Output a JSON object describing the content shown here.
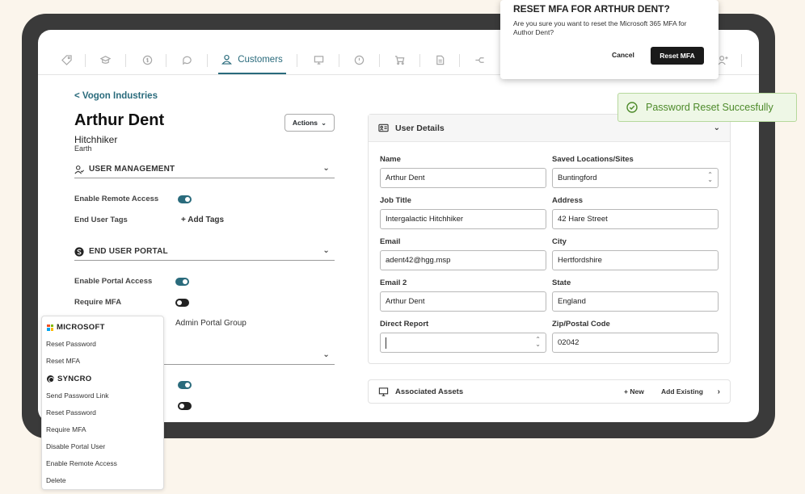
{
  "tabs": {
    "active_label": "Customers",
    "icons": [
      "tag-icon",
      "grad-cap-icon",
      "money-icon",
      "chat-icon",
      "user-icon",
      "monitor-icon",
      "alert-icon",
      "cart-icon",
      "document-icon",
      "flow-icon",
      "add-user-icon"
    ]
  },
  "customer": {
    "back_link": "< Vogon Industries",
    "name": "Arthur Dent",
    "role": "Hitchhiker",
    "location": "Earth",
    "actions_label": "Actions"
  },
  "user_management": {
    "heading": "USER MANAGEMENT",
    "remote_access_label": "Enable Remote Access",
    "remote_access_on": true,
    "tags_label": "End User Tags",
    "add_tags_label": "+ Add Tags"
  },
  "end_user_portal": {
    "heading": "END USER PORTAL",
    "portal_access_label": "Enable Portal Access",
    "portal_access_on": true,
    "require_mfa_label": "Require MFA",
    "require_mfa_on": false,
    "admin_portal_group_label": "Admin Portal Group"
  },
  "extra_toggles": [
    true,
    false
  ],
  "user_details": {
    "heading": "User Details",
    "fields": {
      "name_label": "Name",
      "name_value": "Arthur Dent",
      "saved_locations_label": "Saved Locations/Sites",
      "saved_locations_value": "Buntingford",
      "job_title_label": "Job Title",
      "job_title_value": "Intergalactic Hitchhiker",
      "address_label": "Address",
      "address_value": "42 Hare Street",
      "email_label": "Email",
      "email_value": "adent42@hgg.msp",
      "city_label": "City",
      "city_value": "Hertfordshire",
      "email2_label": "Email 2",
      "email2_value": "Arthur Dent",
      "state_label": "State",
      "state_value": "England",
      "direct_report_label": "Direct Report",
      "direct_report_value": "",
      "zip_label": "Zip/Postal Code",
      "zip_value": "02042"
    }
  },
  "associated_assets": {
    "heading": "Associated Assets",
    "new_label": "+ New",
    "add_existing_label": "Add Existing"
  },
  "modal": {
    "title": "RESET MFA FOR ARTHUR DENT?",
    "body": "Are you sure you want to reset the Microsoft 365 MFA for Author Dent?",
    "cancel_label": "Cancel",
    "confirm_label": "Reset MFA"
  },
  "toast": {
    "message": "Password Reset Succesfully",
    "color": "#4d8a2a"
  },
  "actions_menu": {
    "microsoft_heading": "MICROSOFT",
    "microsoft_items": [
      "Reset Password",
      "Reset MFA"
    ],
    "syncro_heading": "SYNCRO",
    "syncro_items": [
      "Send Password Link",
      "Reset Password",
      "Require MFA",
      "Disable Portal User",
      "Enable Remote Access",
      "Delete"
    ]
  },
  "colors": {
    "accent": "#2a6b7c",
    "background": "#fbf5ec",
    "device_frame": "#3a3a3a"
  }
}
